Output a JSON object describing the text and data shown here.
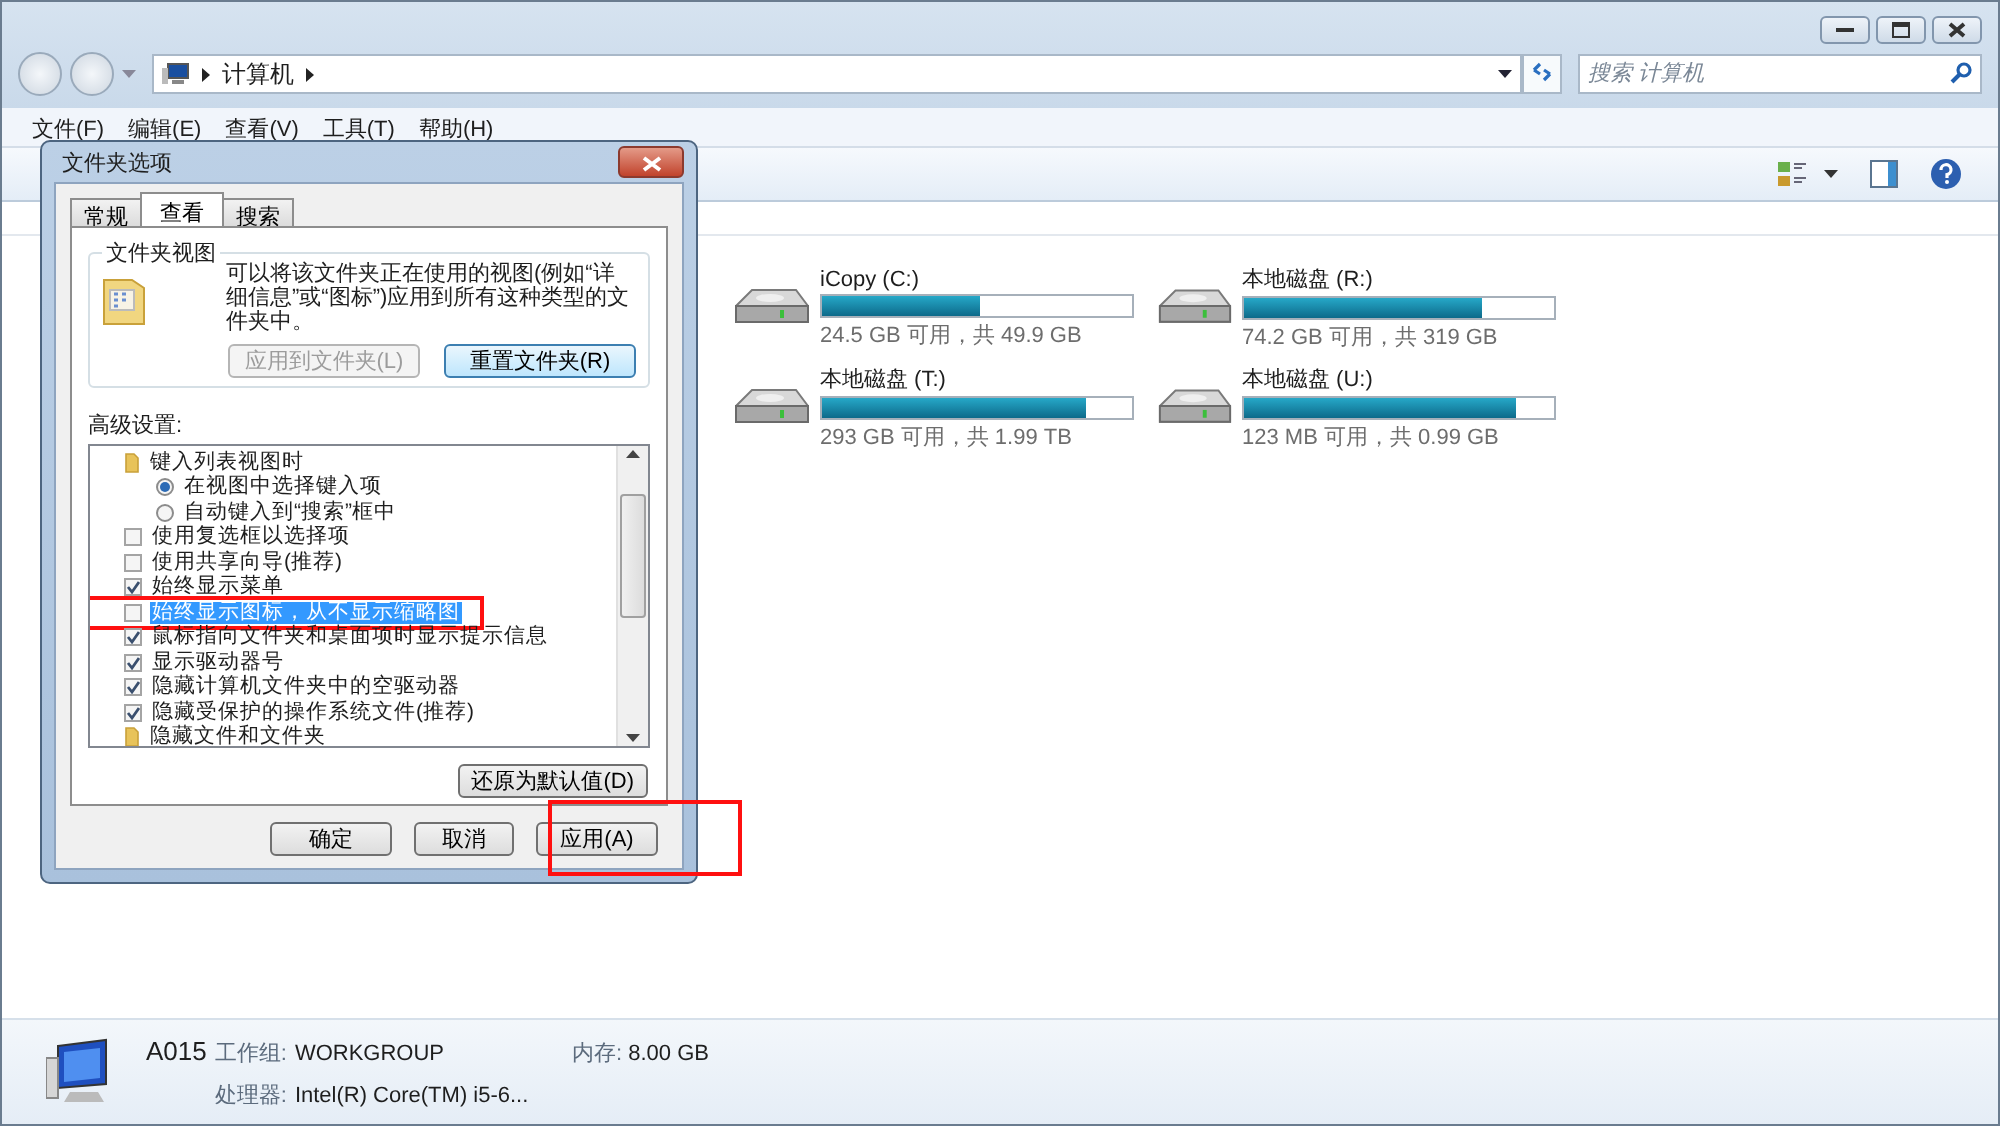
{
  "address": {
    "path": [
      "计算机"
    ],
    "search_placeholder": "搜索 计算机"
  },
  "menu": [
    "文件(F)",
    "编辑(E)",
    "查看(V)",
    "工具(T)",
    "帮助(H)"
  ],
  "drives": [
    {
      "name": "iCopy (C:)",
      "free": "24.5 GB 可用，共 49.9 GB",
      "level": 0.51
    },
    {
      "name": "本地磁盘 (R:)",
      "free": "74.2 GB 可用，共 319 GB",
      "level": 0.77
    },
    {
      "name": "本地磁盘 (T:)",
      "free": "293 GB 可用，共 1.99 TB",
      "level": 0.85
    },
    {
      "name": "本地磁盘 (U:)",
      "free": "123 MB 可用，共 0.99 GB",
      "level": 0.88
    }
  ],
  "details": {
    "name": "A015",
    "fields": [
      {
        "label": "工作组:",
        "value": "WORKGROUP"
      },
      {
        "label": "内存:",
        "value": "8.00 GB"
      },
      {
        "label": "处理器:",
        "value": "Intel(R) Core(TM) i5-6..."
      }
    ]
  },
  "dialog": {
    "title": "文件夹选项",
    "tabs": [
      {
        "label": "常规",
        "selected": false
      },
      {
        "label": "查看",
        "selected": true
      },
      {
        "label": "搜索",
        "selected": false
      }
    ],
    "folder_views": {
      "title": "文件夹视图",
      "text": "可以将该文件夹正在使用的视图(例如“详细信息”或“图标”)应用到所有这种类型的文件夹中。",
      "buttons": [
        {
          "label": "应用到文件夹(L)",
          "disabled": true
        },
        {
          "label": "重置文件夹(R)",
          "disabled": false
        }
      ]
    },
    "advanced": {
      "title": "高级设置:",
      "items": [
        {
          "kind": "folder",
          "label": "键入列表视图时",
          "children": [
            {
              "kind": "radio",
              "label": "在视图中选择键入项",
              "checked": true,
              "selected": false
            },
            {
              "kind": "radio",
              "label": "自动键入到“搜索”框中",
              "checked": false,
              "selected": false
            }
          ]
        },
        {
          "kind": "checkbox",
          "label": "使用复选框以选择项",
          "checked": false,
          "selected": false
        },
        {
          "kind": "checkbox",
          "label": "使用共享向导(推荐)",
          "checked": false,
          "selected": false
        },
        {
          "kind": "checkbox",
          "label": "始终显示菜单",
          "checked": true,
          "selected": false
        },
        {
          "kind": "checkbox",
          "label": "始终显示图标，从不显示缩略图",
          "checked": false,
          "selected": true
        },
        {
          "kind": "checkbox",
          "label": "鼠标指向文件夹和桌面项时显示提示信息",
          "checked": true,
          "selected": false
        },
        {
          "kind": "checkbox",
          "label": "显示驱动器号",
          "checked": true,
          "selected": false
        },
        {
          "kind": "checkbox",
          "label": "隐藏计算机文件夹中的空驱动器",
          "checked": true,
          "selected": false
        },
        {
          "kind": "checkbox",
          "label": "隐藏受保护的操作系统文件(推荐)",
          "checked": true,
          "selected": false
        },
        {
          "kind": "folder",
          "label": "隐藏文件和文件夹"
        }
      ],
      "restore": "还原为默认值(D)"
    },
    "buttons": [
      {
        "label": "确定"
      },
      {
        "label": "取消"
      },
      {
        "label": "应用(A)"
      }
    ]
  },
  "annotations": [
    {
      "kind": "box"
    },
    {
      "kind": "box"
    }
  ]
}
